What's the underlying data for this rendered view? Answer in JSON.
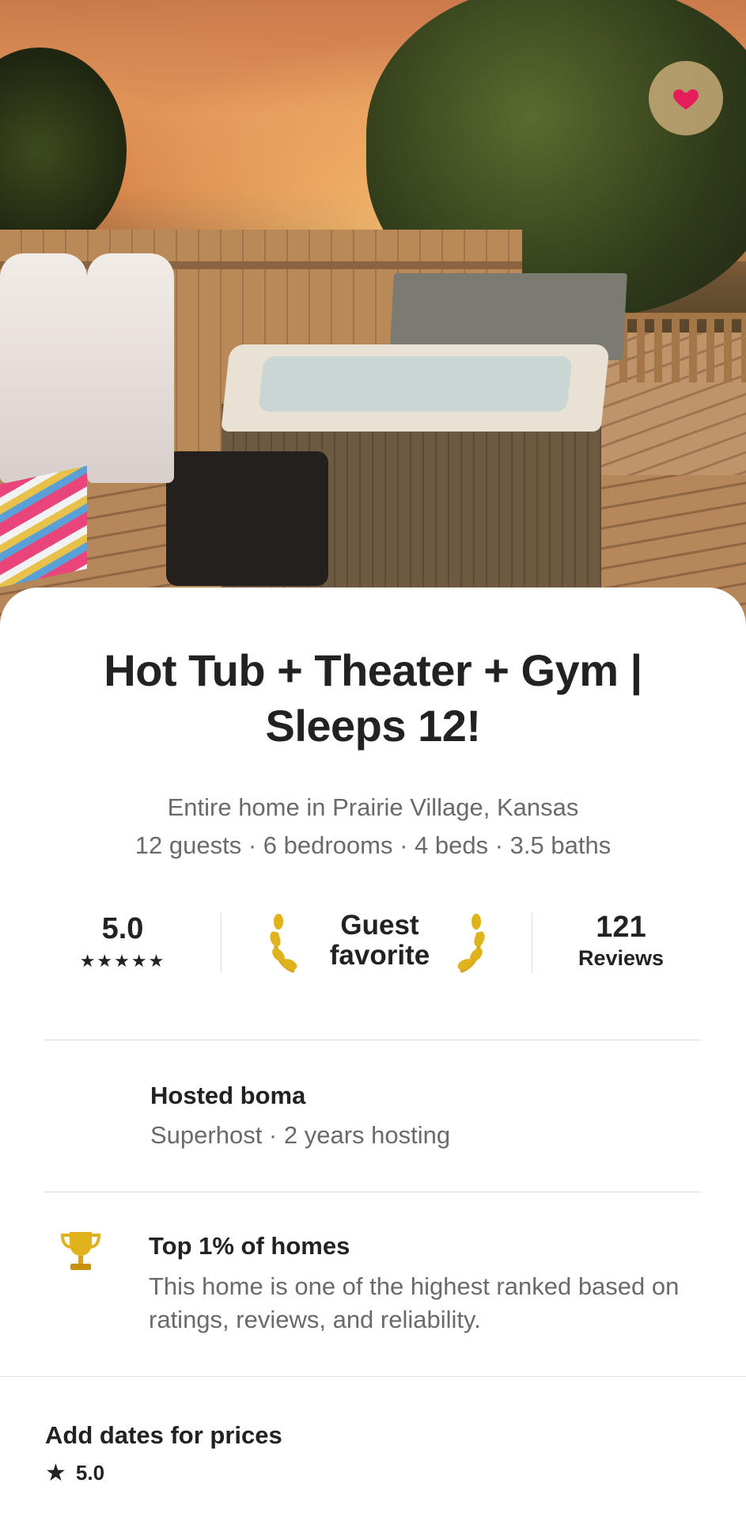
{
  "listing": {
    "title": "Hot Tub + Theater + Gym | Sleeps 12!",
    "location": "Entire home in Prairie Village, Kansas",
    "details": "12 guests · 6 bedrooms · 4 beds · 3.5 baths"
  },
  "stats": {
    "rating": "5.0",
    "stars": "★★★★★",
    "guest_favorite_line1": "Guest",
    "guest_favorite_line2": "favorite",
    "reviews_count": "121",
    "reviews_label": "Reviews"
  },
  "host": {
    "name": "Hosted boma",
    "meta": "Superhost · 2 years hosting"
  },
  "highlight": {
    "title": "Top 1% of homes",
    "description": "This home is one of the highest ranked based on ratings, reviews, and reliability."
  },
  "booking_bar": {
    "prompt": "Add dates for prices",
    "rating": "5.0"
  },
  "colors": {
    "heart": "#e51d5b",
    "trophy": "#e0b21b"
  }
}
